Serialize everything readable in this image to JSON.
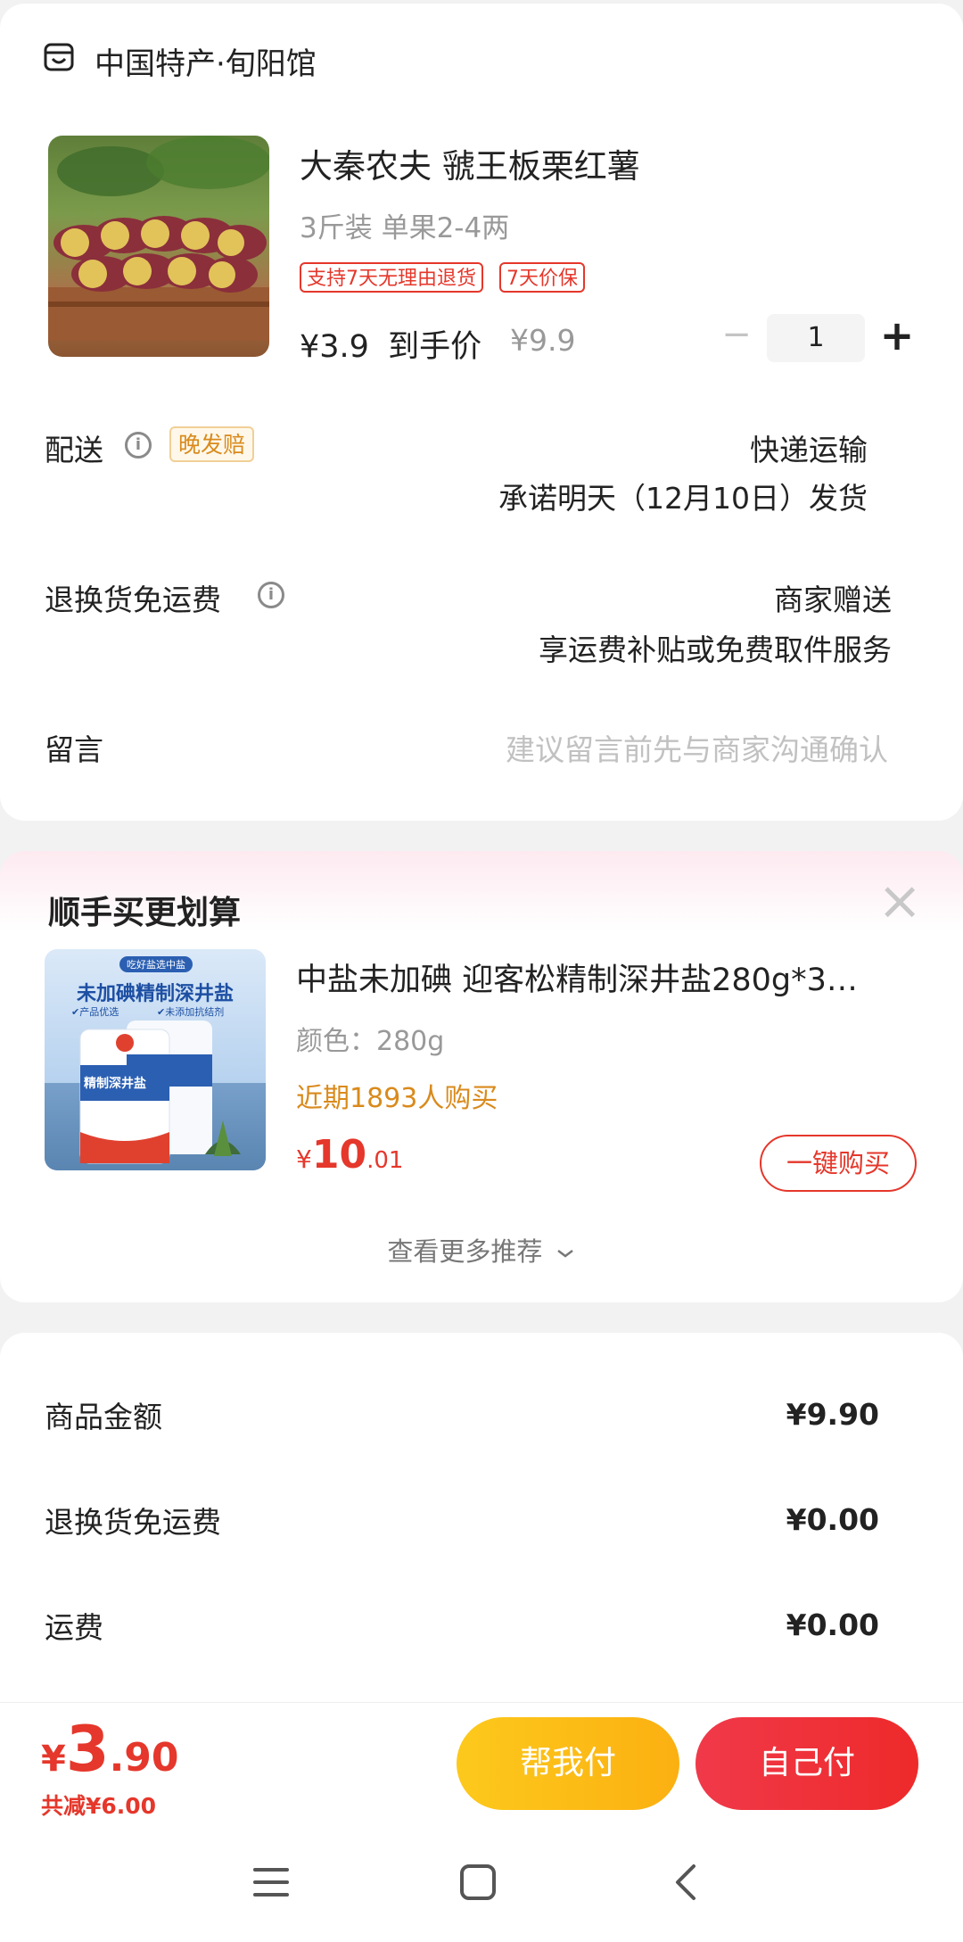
{
  "shop": {
    "icon": "shop-icon",
    "name": "中国特产·旬阳馆"
  },
  "product": {
    "title": "大秦农夫 虢王板栗红薯",
    "spec": "3斤装 单果2-4两",
    "tags": [
      "支持7天无理由退货",
      "7天价保"
    ],
    "price_symbol": "¥",
    "price": "3.9",
    "price_suffix": "到手价",
    "original_price": "¥9.9",
    "quantity": "1",
    "minus": "−",
    "plus": "+"
  },
  "delivery": {
    "label": "配送",
    "badge": "晚发赔",
    "method": "快递运输",
    "promise": "承诺明天（12月10日）发货"
  },
  "return_free": {
    "label": "退换货免运费",
    "value": "商家赠送",
    "desc": "享运费补贴或免费取件服务"
  },
  "message": {
    "label": "留言",
    "placeholder": "建议留言前先与商家沟通确认"
  },
  "recommend": {
    "header": "顺手买更划算",
    "close": "×",
    "item": {
      "title": "中盐未加碘 迎客松精制深井盐280g*3…",
      "color": "颜色：280g",
      "sales": "近期1893人购买",
      "price_symbol": "¥",
      "price_int": "10",
      "price_dec": ".01",
      "buy_button": "一键购买",
      "image_text": {
        "top": "吃好盐选中盐",
        "banner": "未加碘精制深井盐",
        "sub1": "✔产品优选",
        "sub2": "✔未添加抗结剂",
        "bag": "精制深井盐"
      }
    },
    "more": "查看更多推荐",
    "more_icon": "chevron-down-icon"
  },
  "summary": {
    "rows": [
      {
        "label": "商品金额",
        "value": "¥9.90"
      },
      {
        "label": "退换货免运费",
        "value": "¥0.00"
      },
      {
        "label": "运费",
        "value": "¥0.00"
      }
    ]
  },
  "bottom_bar": {
    "total_symbol": "¥",
    "total_int": "3",
    "total_dec": ".90",
    "discount": "共减¥6.00",
    "help_pay": "帮我付",
    "self_pay": "自己付"
  },
  "colors": {
    "red": "#e5372b",
    "orange_text": "#d98a1c",
    "yellow_button": "#fdbc15",
    "red_button": "#ee2e36"
  }
}
